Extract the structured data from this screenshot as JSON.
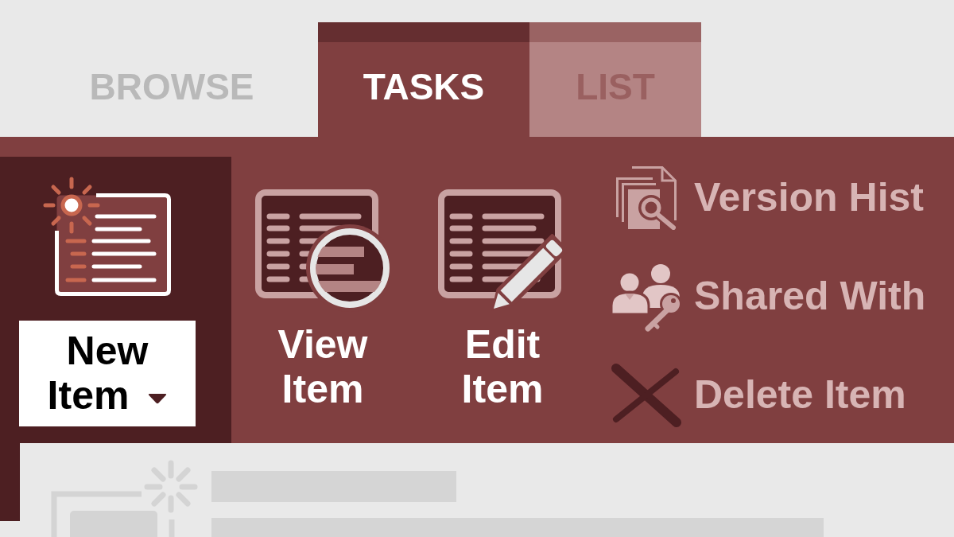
{
  "tabs": [
    {
      "label": "BROWSE",
      "kind": "plain",
      "selected": false
    },
    {
      "label": "TASKS",
      "kind": "tab",
      "selected": true
    },
    {
      "label": "LIST",
      "kind": "tab",
      "selected": false
    }
  ],
  "ribbon": {
    "large_buttons": [
      {
        "label": "New Item",
        "kind": "new",
        "selected": true,
        "dropdown": true
      },
      {
        "label": "View Item",
        "kind": "view",
        "selected": false,
        "dropdown": false
      },
      {
        "label": "Edit Item",
        "kind": "edit",
        "selected": false,
        "dropdown": false
      }
    ],
    "small_buttons": [
      {
        "label": "Version Hist",
        "kind": "history"
      },
      {
        "label": "Shared With",
        "kind": "share"
      },
      {
        "label": "Delete Item",
        "kind": "delete"
      }
    ]
  }
}
